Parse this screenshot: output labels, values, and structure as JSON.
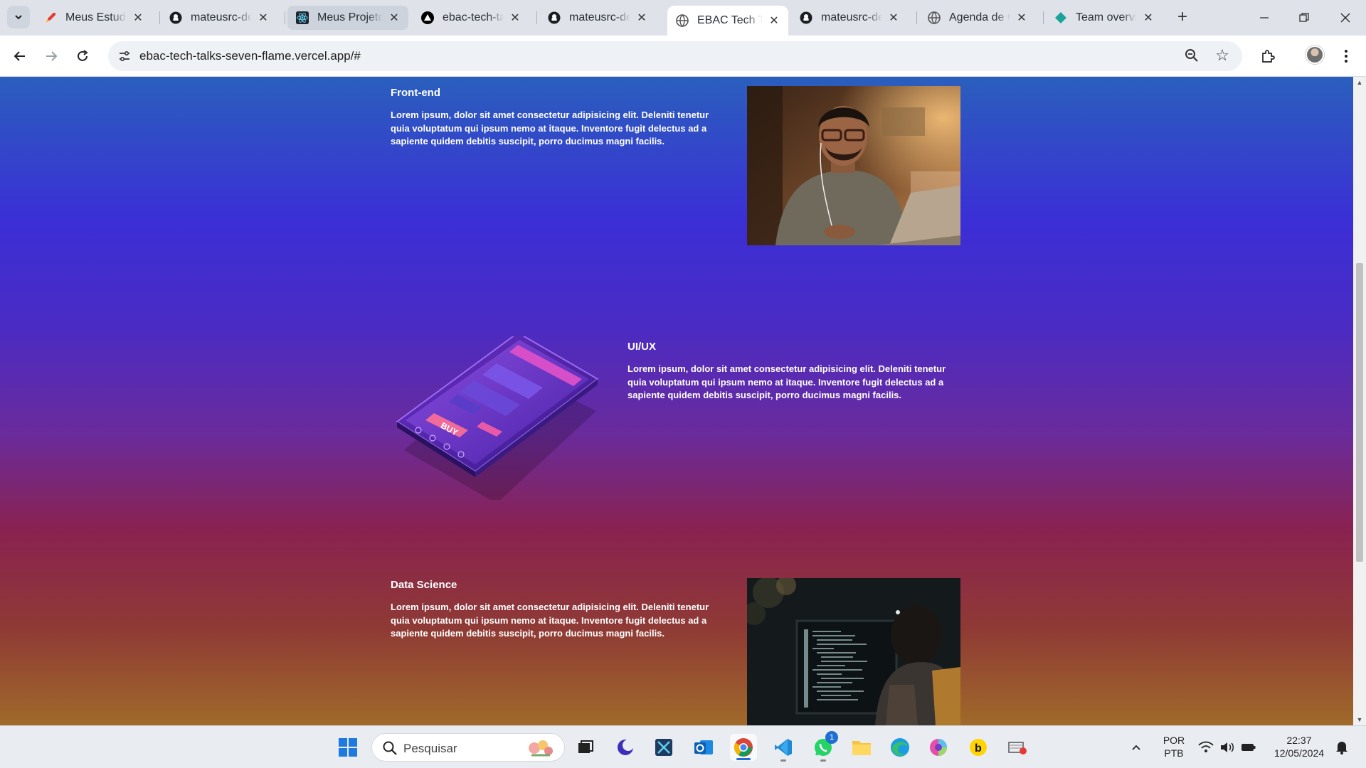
{
  "browser": {
    "tabs": [
      {
        "title": "Meus Estudos",
        "icon": "rocket-icon"
      },
      {
        "title": "mateusrc-dev",
        "icon": "github-icon"
      },
      {
        "title": "Meus Projetos",
        "icon": "react-icon"
      },
      {
        "title": "ebac-tech-talks",
        "icon": "vercel-icon"
      },
      {
        "title": "mateusrc-dev",
        "icon": "github-icon"
      },
      {
        "title": "EBAC Tech Talks",
        "icon": "globe-icon"
      },
      {
        "title": "mateusrc-dev",
        "icon": "github-icon"
      },
      {
        "title": "Agenda de Contatos",
        "icon": "globe-icon"
      },
      {
        "title": "Team overview",
        "icon": "diamond-icon"
      }
    ],
    "active_tab_index": 5,
    "url": "ebac-tech-talks-seven-flame.vercel.app/#"
  },
  "page": {
    "sections": [
      {
        "title": "Front-end",
        "text": "Lorem ipsum, dolor sit amet consectetur adipisicing elit. Deleniti tenetur quia voluptatum qui ipsum nemo at itaque. Inventore fugit delectus ad a sapiente quidem debitis suscipit, porro ducimus magni facilis.",
        "image": "man-working-on-laptop-photo"
      },
      {
        "title": "UI/UX",
        "text": "Lorem ipsum, dolor sit amet consectetur adipisicing elit. Deleniti tenetur quia voluptatum qui ipsum nemo at itaque. Inventore fugit delectus ad a sapiente quidem debitis suscipit, porro ducimus magni facilis.",
        "image": "isometric-phone-illustration",
        "phone_button": "BUY"
      },
      {
        "title": "Data Science",
        "text": "Lorem ipsum, dolor sit amet consectetur adipisicing elit. Deleniti tenetur quia voluptatum qui ipsum nemo at itaque. Inventore fugit delectus ad a sapiente quidem debitis suscipit, porro ducimus magni facilis.",
        "image": "person-coding-at-monitor-photo"
      }
    ]
  },
  "taskbar": {
    "search_placeholder": "Pesquisar",
    "whatsapp_badge": "1",
    "language": "POR",
    "layout": "PTB",
    "time": "22:37",
    "date": "12/05/2024"
  }
}
